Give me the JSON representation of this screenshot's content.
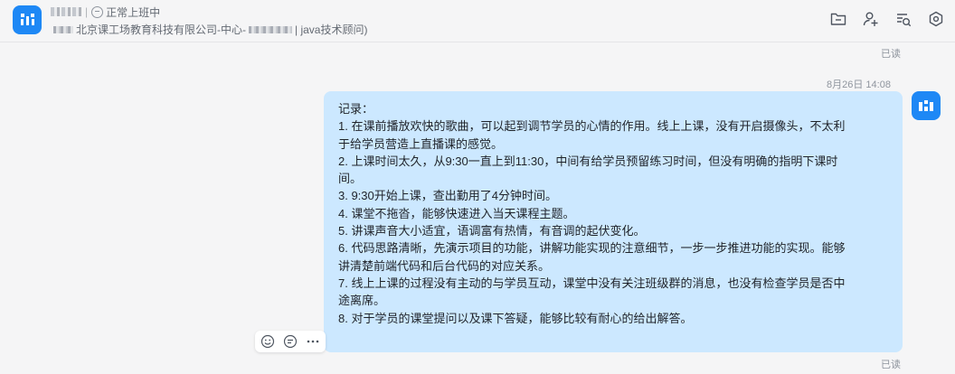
{
  "header": {
    "contact_status": "正常上班中",
    "org_prefix": "北京课工场教育科技有限公司-中心-",
    "org_suffix": "| java技术顾问)",
    "icons": [
      "folder-icon",
      "add-member-icon",
      "search-messages-icon",
      "settings-icon"
    ]
  },
  "messages": {
    "read_top": "已读",
    "timestamp": "8月26日 14:08",
    "read_bottom": "已读",
    "lines": [
      "记录：",
      "1. 在课前播放欢快的歌曲，可以起到调节学员的心情的作用。线上上课，没有开启摄像头，不太利",
      "于给学员营造上直播课的感觉。",
      "2. 上课时间太久，从9:30一直上到11:30，中间有给学员预留练习时间，但没有明确的指明下课时",
      "间。",
      "3. 9:30开始上课，查出勤用了4分钟时间。",
      "4. 课堂不拖沓，能够快速进入当天课程主题。",
      "5. 讲课声音大小适宜，语调富有热情，有音调的起伏变化。",
      "6. 代码思路清晰，先演示项目的功能，讲解功能实现的注意细节，一步一步推进功能的实现。能够",
      "讲清楚前端代码和后台代码的对应关系。",
      "7. 线上上课的过程没有主动的与学员互动，课堂中没有关注班级群的消息，也没有检查学员是否中",
      "途离席。",
      "8. 对于学员的课堂提问以及课下答疑，能够比较有耐心的给出解答。"
    ]
  },
  "message_actions": [
    "emoji-reaction-icon",
    "reply-icon",
    "more-icon"
  ],
  "colors": {
    "accent": "#1e88f5",
    "bubble": "#cce8ff",
    "background": "#f5f5f6"
  }
}
